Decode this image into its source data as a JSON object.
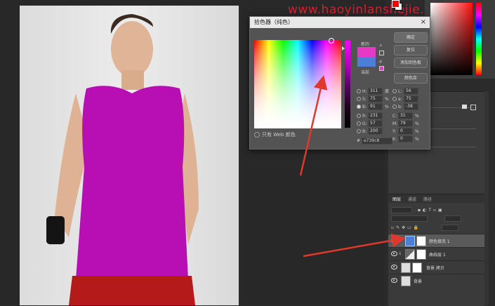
{
  "watermark": "www.haoyinlanshejie.cn",
  "color_picker": {
    "title": "拾色器（纯色）",
    "close_glyph": "×",
    "new_label": "新的",
    "current_label": "当前",
    "only_web_colors": "只有 Web 颜色",
    "buttons": {
      "ok": "确定",
      "reset": "复位",
      "add_swatch": "添加到色板",
      "color_library": "颜色库"
    },
    "fields": {
      "H": {
        "value": "311",
        "unit": "度"
      },
      "S": {
        "value": "75",
        "unit": "%"
      },
      "B": {
        "value": "91",
        "unit": "%"
      },
      "R": {
        "value": "231",
        "unit": ""
      },
      "G": {
        "value": "57",
        "unit": ""
      },
      "Bb": {
        "value": "200",
        "unit": ""
      },
      "L": {
        "value": "56",
        "unit": ""
      },
      "a": {
        "value": "75",
        "unit": ""
      },
      "b": {
        "value": "-38",
        "unit": ""
      },
      "C": {
        "value": "31",
        "unit": "%"
      },
      "M": {
        "value": "79",
        "unit": "%"
      },
      "Y": {
        "value": "0",
        "unit": "%"
      },
      "K": {
        "value": "0",
        "unit": "%"
      }
    },
    "hex_label": "#",
    "hex": "e739c8",
    "new_color": "#e739c8",
    "current_color": "#4a7fdc"
  },
  "layers_panel": {
    "tabs": [
      "图层",
      "通道",
      "路径"
    ],
    "layers": [
      {
        "name": "颜色填充 1",
        "selected": true
      },
      {
        "name": "曲线层 1",
        "selected": false
      },
      {
        "name": "背景 拷贝",
        "selected": false
      },
      {
        "name": "背景",
        "selected": false
      }
    ]
  },
  "colors": {
    "shirt": "#b80fb5",
    "shorts": "#b51a1a",
    "accent_arrow": "#e0382c"
  }
}
